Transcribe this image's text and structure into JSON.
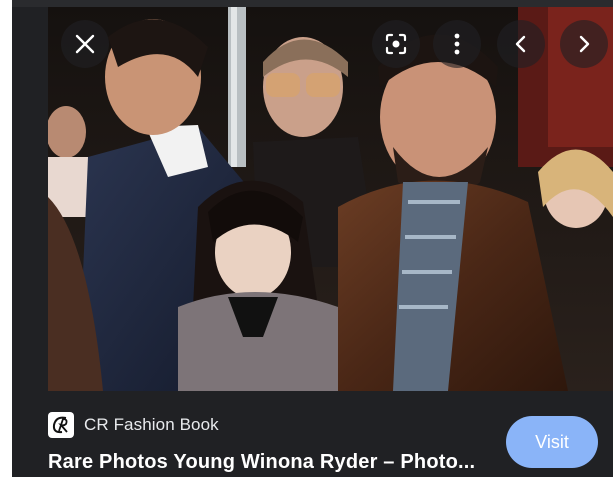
{
  "viewer": {
    "photo_alt": "Rare Photos Young Winona Ryder",
    "controls": {
      "close_icon": "close-icon",
      "lens_icon": "google-lens-icon",
      "more_icon": "more-vertical-icon",
      "prev_icon": "chevron-left-icon",
      "next_icon": "chevron-right-icon"
    }
  },
  "result": {
    "source_name": "CR Fashion Book",
    "source_logo_icon": "cr-fashion-book-logo",
    "title": "Rare Photos Young Winona Ryder – Photo...",
    "visit_label": "Visit"
  },
  "colors": {
    "panel_bg": "#202124",
    "visit_button": "#8ab4f8",
    "text_primary": "#ffffff",
    "text_secondary": "#e8eaed"
  }
}
